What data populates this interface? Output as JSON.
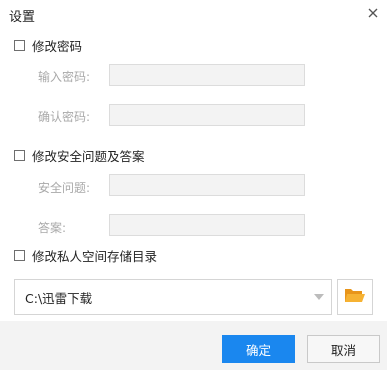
{
  "dialog": {
    "title": "设置"
  },
  "password": {
    "checkbox_label": "修改密码",
    "enter_label": "输入密码:",
    "confirm_label": "确认密码:"
  },
  "security": {
    "checkbox_label": "修改安全问题及答案",
    "question_label": "安全问题:",
    "answer_label": "答案:"
  },
  "private_dir": {
    "checkbox_label": "修改私人空间存储目录",
    "path_value": "C:\\迅雷下载"
  },
  "footer": {
    "ok_label": "确定",
    "cancel_label": "取消"
  },
  "colors": {
    "accent": "#1a87ef",
    "folder": "#f4a721"
  },
  "icons": {
    "close": "close-icon",
    "dropdown": "chevron-down-icon",
    "folder": "folder-open-icon"
  }
}
